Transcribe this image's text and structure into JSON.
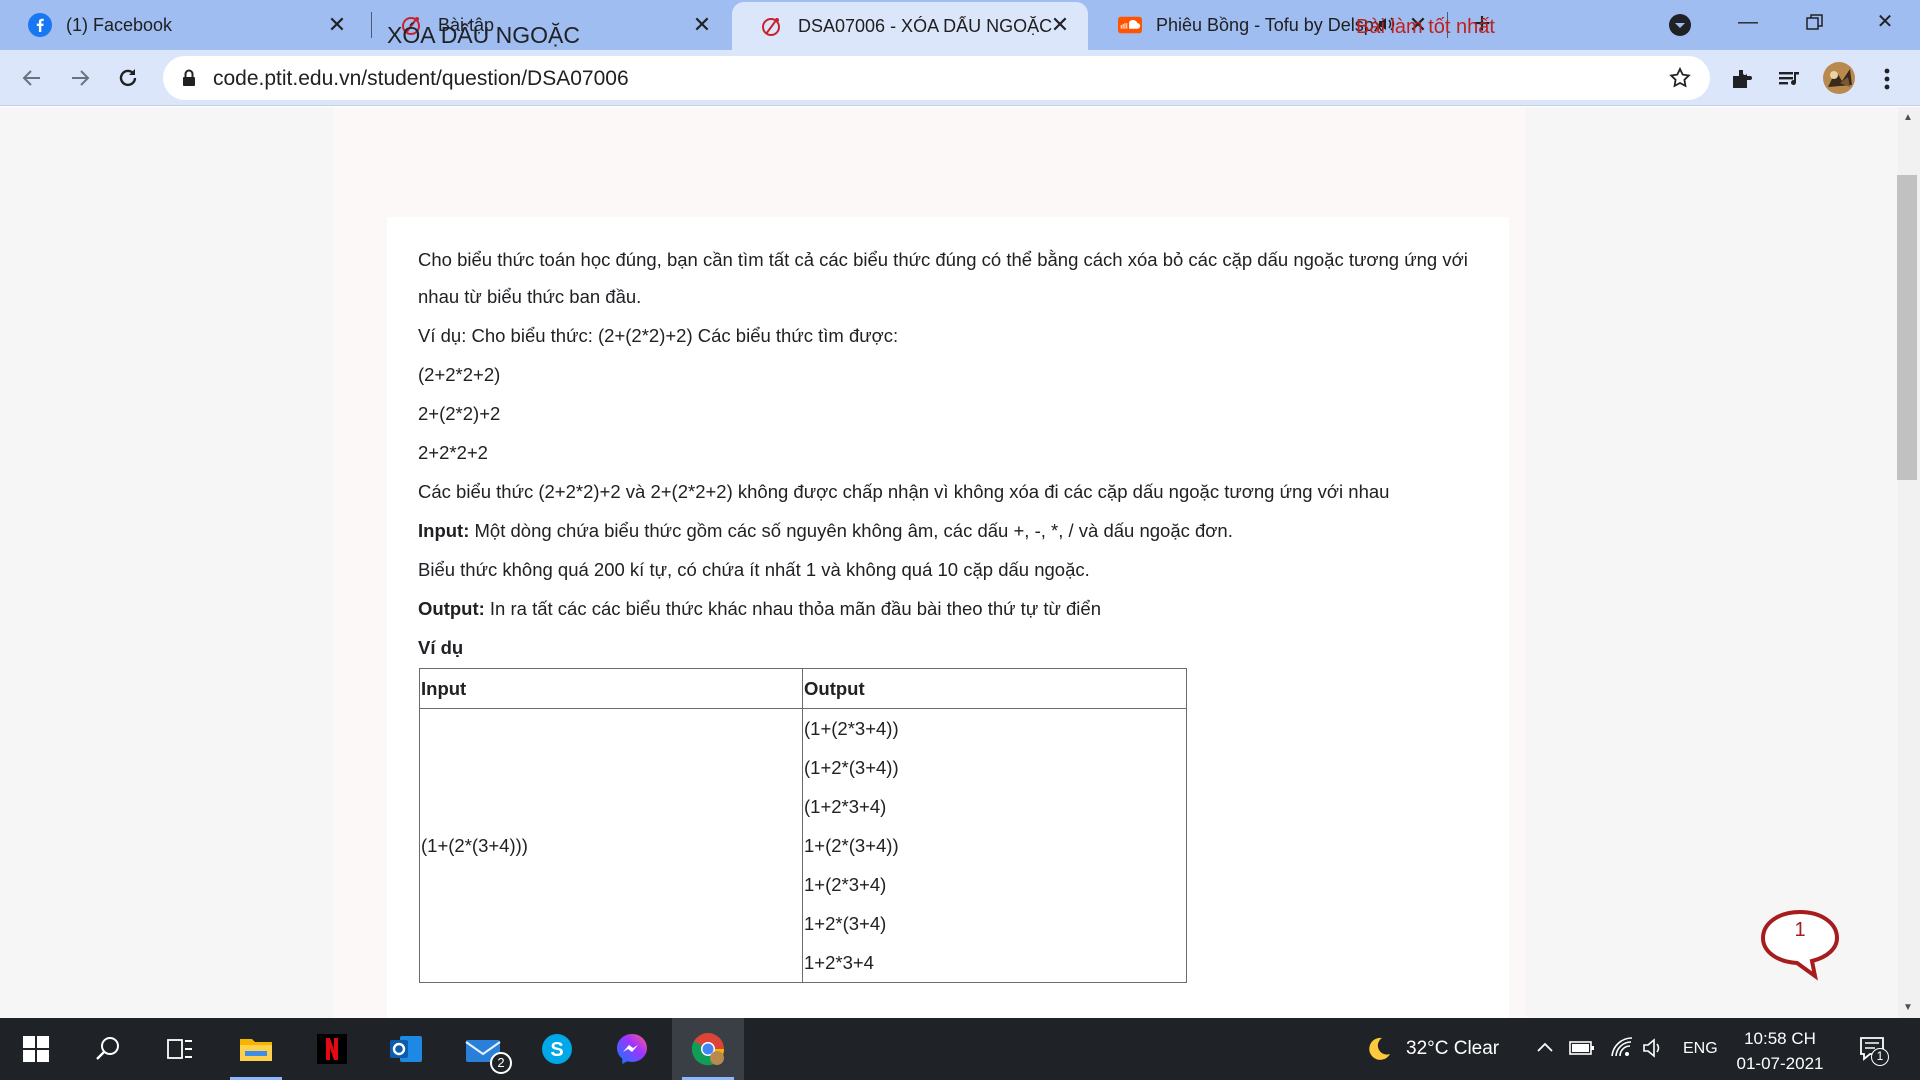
{
  "browser": {
    "tabs": [
      {
        "label": "(1) Facebook",
        "icon": "facebook-icon"
      },
      {
        "label": "Bài tập",
        "icon": "ptit-icon"
      },
      {
        "label": "DSA07006 - XÓA DẤU NGOẶC",
        "icon": "ptit-icon",
        "active": true
      },
      {
        "label": "Phiêu Bồng - Tofu by Delspx",
        "icon": "soundcloud-icon"
      }
    ],
    "url": "code.ptit.edu.vn/student/question/DSA07006"
  },
  "page": {
    "title": "XÓA DẤU NGOẶC",
    "best_link": "Bài làm tốt nhất",
    "problem": {
      "p1": "Cho biểu thức toán học đúng, bạn cần tìm tất cả các biểu thức đúng có thể bằng cách xóa bỏ các cặp dấu ngoặc tương ứng với nhau từ biểu thức ban đầu.",
      "p2": "Ví dụ: Cho biểu thức: (2+(2*2)+2) Các biểu thức tìm được:",
      "ex1": "(2+2*2+2)",
      "ex2": "2+(2*2)+2",
      "ex3": "2+2*2+2",
      "p3": "Các biểu thức (2+2*2)+2 và 2+(2*2+2) không được chấp nhận vì không xóa đi các cặp dấu ngoặc tương ứng với nhau",
      "input_label": "Input:",
      "input_text": " Một dòng chứa biểu thức gồm các số nguyên không âm, các dấu +, -, *, / và dấu ngoặc đơn.",
      "constraint": "Biểu thức không quá 200 kí tự, có chứa ít nhất 1 và không quá 10 cặp dấu ngoặc.",
      "output_label": "Output:",
      "output_text": " In ra tất các các biểu thức khác nhau thỏa mãn đầu bài theo thứ tự từ điển",
      "example_heading": "Ví dụ"
    },
    "example_table": {
      "header_input": "Input",
      "header_output": "Output",
      "input": "(1+(2*(3+4)))",
      "outputs": [
        "(1+(2*3+4))",
        "(1+2*(3+4))",
        "(1+2*3+4)",
        "1+(2*(3+4))",
        "1+(2*3+4)",
        "1+2*(3+4)",
        "1+2*3+4"
      ]
    },
    "chat_badge": "1"
  },
  "taskbar": {
    "mail_badge": "2",
    "weather": "32°C  Clear",
    "language": "ENG",
    "time": "10:58 CH",
    "date": "01-07-2021",
    "notification_badge": "1"
  },
  "colors": {
    "tabstrip": "#9fbdf0",
    "active_tab": "#dbe6fb",
    "link_red": "#c0201c",
    "taskbar": "#1f2327"
  }
}
